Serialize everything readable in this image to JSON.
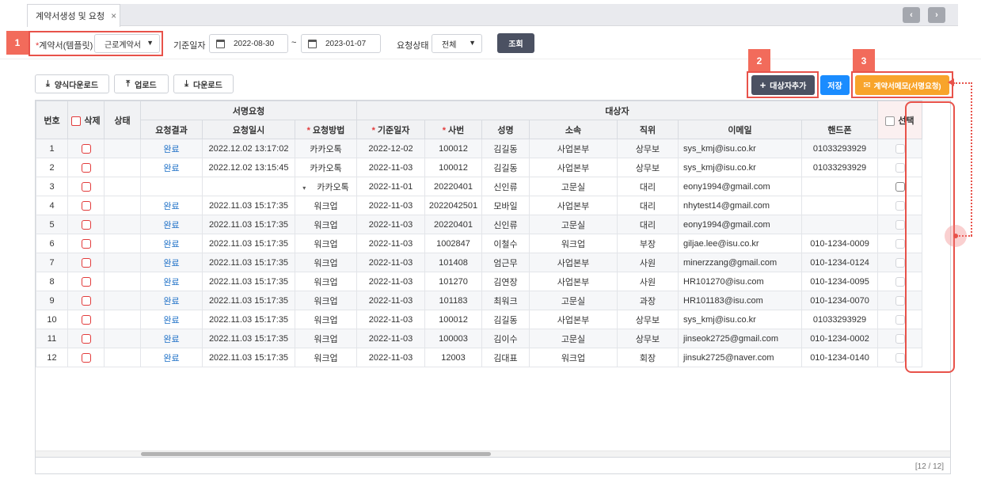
{
  "tab": {
    "label": "계약서생성 및 요청",
    "close": "×"
  },
  "nav": {
    "prev": "‹",
    "next": "›"
  },
  "badges": {
    "b1": "1",
    "b2": "2",
    "b3": "3"
  },
  "filter": {
    "contract_label_req": "*",
    "contract_label": "계약서(템플릿)",
    "contract_value": "근로계약서",
    "date_label": "기준일자",
    "date_from": "2022-08-30",
    "date_sep": "~",
    "date_to": "2023-01-07",
    "status_label": "요청상태",
    "status_value": "전체",
    "search_button": "조회"
  },
  "actions": {
    "form_download": "양식다운로드",
    "upload": "업로드",
    "download": "다운로드",
    "add_target": "대상자추가",
    "save": "저장",
    "contract_memo": "계약서메모(서명요청)"
  },
  "grid": {
    "group_sign": "서명요청",
    "group_target": "대상자",
    "headers": {
      "no": "번호",
      "delete": "삭제",
      "status": "상태",
      "result": "요청결과",
      "req_time": "요청일시",
      "method": "요청방법",
      "base_date": "기준일자",
      "emp_no": "사번",
      "name": "성명",
      "dept": "소속",
      "position": "직위",
      "email": "이메일",
      "phone": "핸드폰",
      "select": "선택"
    },
    "rows": [
      {
        "no": "1",
        "result": "완료",
        "req_time": "2022.12.02 13:17:02",
        "method": "카카오톡",
        "base_date": "2022-12-02",
        "emp_no": "100012",
        "name": "김길동",
        "dept": "사업본부",
        "position": "상무보",
        "email": "sys_kmj@isu.co.kr",
        "phone": "01033293929"
      },
      {
        "no": "2",
        "result": "완료",
        "req_time": "2022.12.02 13:15:45",
        "method": "카카오톡",
        "base_date": "2022-11-03",
        "emp_no": "100012",
        "name": "김길동",
        "dept": "사업본부",
        "position": "상무보",
        "email": "sys_kmj@isu.co.kr",
        "phone": "01033293929"
      },
      {
        "no": "3",
        "result": "",
        "req_time": "",
        "method": "카카오톡",
        "base_date": "2022-11-01",
        "emp_no": "20220401",
        "name": "신인류",
        "dept": "고문실",
        "position": "대리",
        "email": "eony1994@gmail.com",
        "phone": ""
      },
      {
        "no": "4",
        "result": "완료",
        "req_time": "2022.11.03 15:17:35",
        "method": "워크업",
        "base_date": "2022-11-03",
        "emp_no": "2022042501",
        "name": "모바일",
        "dept": "사업본부",
        "position": "대리",
        "email": "nhytest14@gmail.com",
        "phone": ""
      },
      {
        "no": "5",
        "result": "완료",
        "req_time": "2022.11.03 15:17:35",
        "method": "워크업",
        "base_date": "2022-11-03",
        "emp_no": "20220401",
        "name": "신인류",
        "dept": "고문실",
        "position": "대리",
        "email": "eony1994@gmail.com",
        "phone": ""
      },
      {
        "no": "6",
        "result": "완료",
        "req_time": "2022.11.03 15:17:35",
        "method": "워크업",
        "base_date": "2022-11-03",
        "emp_no": "1002847",
        "name": "이철수",
        "dept": "워크업",
        "position": "부장",
        "email": "giljae.lee@isu.co.kr",
        "phone": "010-1234-0009"
      },
      {
        "no": "7",
        "result": "완료",
        "req_time": "2022.11.03 15:17:35",
        "method": "워크업",
        "base_date": "2022-11-03",
        "emp_no": "101408",
        "name": "엄근무",
        "dept": "사업본부",
        "position": "사원",
        "email": "minerzzang@gmail.com",
        "phone": "010-1234-0124"
      },
      {
        "no": "8",
        "result": "완료",
        "req_time": "2022.11.03 15:17:35",
        "method": "워크업",
        "base_date": "2022-11-03",
        "emp_no": "101270",
        "name": "김연장",
        "dept": "사업본부",
        "position": "사원",
        "email": "HR101270@isu.com",
        "phone": "010-1234-0095"
      },
      {
        "no": "9",
        "result": "완료",
        "req_time": "2022.11.03 15:17:35",
        "method": "워크업",
        "base_date": "2022-11-03",
        "emp_no": "101183",
        "name": "최워크",
        "dept": "고문실",
        "position": "과장",
        "email": "HR101183@isu.com",
        "phone": "010-1234-0070"
      },
      {
        "no": "10",
        "result": "완료",
        "req_time": "2022.11.03 15:17:35",
        "method": "워크업",
        "base_date": "2022-11-03",
        "emp_no": "100012",
        "name": "김길동",
        "dept": "사업본부",
        "position": "상무보",
        "email": "sys_kmj@isu.co.kr",
        "phone": "01033293929"
      },
      {
        "no": "11",
        "result": "완료",
        "req_time": "2022.11.03 15:17:35",
        "method": "워크업",
        "base_date": "2022-11-03",
        "emp_no": "100003",
        "name": "김이수",
        "dept": "고문실",
        "position": "상무보",
        "email": "jinseok2725@gmail.com",
        "phone": "010-1234-0002"
      },
      {
        "no": "12",
        "result": "완료",
        "req_time": "2022.11.03 15:17:35",
        "method": "워크업",
        "base_date": "2022-11-03",
        "emp_no": "12003",
        "name": "김대표",
        "dept": "워크업",
        "position": "회장",
        "email": "jinsuk2725@naver.com",
        "phone": "010-1234-0140"
      }
    ],
    "count": "[12 / 12]"
  },
  "colors": {
    "accent_red": "#e8524a",
    "badge": "#f26b5b",
    "dark_button": "#4b5162",
    "blue_button": "#1a8cff",
    "orange_button": "#f8a42b",
    "link": "#1c6fc7"
  }
}
